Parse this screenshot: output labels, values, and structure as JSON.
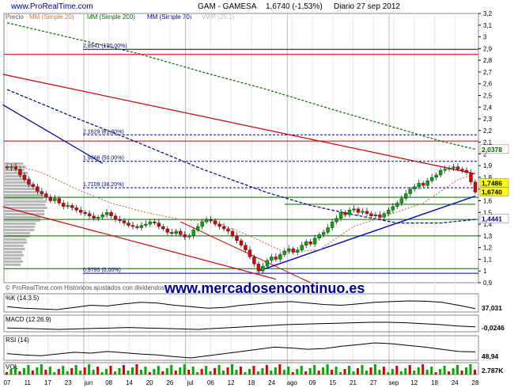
{
  "header": {
    "brand": "www.ProRealTime.com",
    "instrument": "GAM - GAMESA",
    "quote": "1,6740 (-1,53%)",
    "period": "Diario  27 sep 2012"
  },
  "legend": {
    "price": "Precio",
    "ma20": "MM (Simple 20)",
    "ma200": "MM (Simple 200)",
    "ma70": "MM (Simple 70)",
    "vwp": "VWP (25.1)"
  },
  "footer_note": "© ProRealTime.com  Históricos ajustados con dividendos",
  "watermark": "www.mercadosencontinuo.es",
  "colors": {
    "up": "#00aa00",
    "down": "#dd0000",
    "ma20": "#cc7755",
    "ma200": "#006600",
    "ma70": "#000099",
    "fib": "#0000aa",
    "resistance": "#cc0000",
    "support": "#006600",
    "trendline": "#0000cc",
    "watermark": "#000099",
    "highlight": "#ffff00"
  },
  "chart_data": {
    "type": "candlestick",
    "title": "GAM - GAMESA",
    "ylim": [
      0.9,
      3.2
    ],
    "yticks": [
      "3,2",
      "3,1",
      "3",
      "2,9",
      "2,8",
      "2,7",
      "2,6",
      "2,5",
      "2,4",
      "2,3",
      "2,2",
      "2,1",
      "2",
      "1,9",
      "1,8",
      "1,7",
      "1,6",
      "1,5",
      "1,4",
      "1,3",
      "1,2",
      "1,1",
      "1",
      "0,9"
    ],
    "xticks": [
      "07",
      "11",
      "17",
      "23",
      "jun",
      "08",
      "14",
      "20",
      "26",
      "jul",
      "06",
      "12",
      "18",
      "24",
      "ago",
      "09",
      "15",
      "21",
      "27",
      "sep",
      "12",
      "18",
      "24",
      "28"
    ],
    "fibonacci": [
      {
        "label": "2,8941 (100,00%)",
        "value": 2.894
      },
      {
        "label": "2,1629 (61,80%)",
        "value": 2.163
      },
      {
        "label": "1,9368 (50,00%)",
        "value": 1.937
      },
      {
        "label": "1,7109 (38,20%)",
        "value": 1.711
      },
      {
        "label": "0,9795 (0,00%)",
        "value": 0.98
      }
    ],
    "horizontal_levels": [
      {
        "value": 2.85,
        "color": "resistance"
      },
      {
        "value": 2.11,
        "color": "resistance"
      },
      {
        "value": 1.63,
        "color": "support"
      },
      {
        "value": 1.44,
        "color": "support"
      },
      {
        "value": 1.3,
        "color": "support"
      },
      {
        "value": 1.02,
        "color": "support"
      }
    ],
    "price_labels": [
      {
        "text": "2,0378",
        "value": 2.0378,
        "style": "green"
      },
      {
        "text": "1,7486",
        "value": 1.7486,
        "style": "highlight"
      },
      {
        "text": "1,6740",
        "value": 1.674,
        "style": "highlight"
      },
      {
        "text": "1,4441",
        "value": 1.4441,
        "style": "blue"
      }
    ],
    "close": [
      1.88,
      1.89,
      1.87,
      1.82,
      1.78,
      1.74,
      1.72,
      1.68,
      1.66,
      1.63,
      1.6,
      1.62,
      1.58,
      1.55,
      1.56,
      1.54,
      1.52,
      1.5,
      1.49,
      1.47,
      1.45,
      1.46,
      1.48,
      1.5,
      1.47,
      1.44,
      1.43,
      1.41,
      1.39,
      1.38,
      1.37,
      1.39,
      1.4,
      1.42,
      1.41,
      1.38,
      1.36,
      1.33,
      1.32,
      1.34,
      1.31,
      1.29,
      1.3,
      1.35,
      1.38,
      1.42,
      1.44,
      1.43,
      1.4,
      1.38,
      1.36,
      1.34,
      1.3,
      1.26,
      1.22,
      1.18,
      1.12,
      1.06,
      1.0,
      1.04,
      1.09,
      1.12,
      1.1,
      1.14,
      1.17,
      1.19,
      1.16,
      1.18,
      1.22,
      1.25,
      1.23,
      1.28,
      1.31,
      1.33,
      1.37,
      1.42,
      1.45,
      1.5,
      1.48,
      1.52,
      1.53,
      1.5,
      1.51,
      1.49,
      1.47,
      1.48,
      1.46,
      1.49,
      1.52,
      1.55,
      1.58,
      1.62,
      1.66,
      1.7,
      1.72,
      1.75,
      1.73,
      1.77,
      1.8,
      1.82,
      1.86,
      1.87,
      1.88,
      1.89,
      1.87,
      1.86,
      1.84,
      1.76,
      1.674
    ],
    "moving_averages": [
      {
        "name": "MM (Simple 200)",
        "color": "ma200",
        "points": [
          [
            0,
            3.12
          ],
          [
            15,
            2.99
          ],
          [
            30,
            2.86
          ],
          [
            45,
            2.7
          ],
          [
            60,
            2.55
          ],
          [
            75,
            2.38
          ],
          [
            90,
            2.22
          ],
          [
            100,
            2.11
          ],
          [
            108,
            2.04
          ]
        ]
      },
      {
        "name": "MM (Simple 70)",
        "color": "ma70",
        "points": [
          [
            0,
            2.55
          ],
          [
            15,
            2.32
          ],
          [
            30,
            2.1
          ],
          [
            45,
            1.87
          ],
          [
            60,
            1.67
          ],
          [
            70,
            1.56
          ],
          [
            80,
            1.48
          ],
          [
            90,
            1.41
          ],
          [
            100,
            1.41
          ],
          [
            108,
            1.44
          ]
        ]
      },
      {
        "name": "MM (Simple 20)",
        "color": "ma20",
        "points": [
          [
            0,
            1.92
          ],
          [
            8,
            1.84
          ],
          [
            16,
            1.7
          ],
          [
            24,
            1.58
          ],
          [
            32,
            1.5
          ],
          [
            40,
            1.44
          ],
          [
            48,
            1.42
          ],
          [
            56,
            1.3
          ],
          [
            64,
            1.16
          ],
          [
            72,
            1.18
          ],
          [
            80,
            1.38
          ],
          [
            88,
            1.48
          ],
          [
            96,
            1.58
          ],
          [
            104,
            1.78
          ],
          [
            108,
            1.83
          ]
        ]
      }
    ],
    "indicators": [
      {
        "label": "%K (14.3.5)",
        "values": [
          50,
          40,
          35,
          30,
          45,
          60,
          55,
          70,
          80,
          75,
          60,
          50,
          40,
          45,
          60,
          70,
          80,
          85,
          75,
          65,
          60,
          70,
          80,
          85,
          90,
          88,
          80,
          60,
          37
        ],
        "readout": "37,031"
      },
      {
        "label": "MACD (12.26.9)",
        "values": [
          -0.05,
          -0.06,
          -0.07,
          -0.08,
          -0.07,
          -0.06,
          -0.05,
          -0.04,
          -0.05,
          -0.06,
          -0.07,
          -0.08,
          -0.06,
          -0.04,
          -0.02,
          0.0,
          0.02,
          0.03,
          0.04,
          0.05,
          0.06,
          0.07,
          0.07,
          0.06,
          0.04,
          0.02,
          -0.01,
          -0.025
        ],
        "readout": "-0,0246"
      },
      {
        "label": "RSI (14)",
        "values": [
          45,
          42,
          40,
          44,
          48,
          46,
          50,
          47,
          44,
          42,
          38,
          35,
          40,
          45,
          50,
          55,
          60,
          58,
          55,
          57,
          62,
          66,
          70,
          68,
          64,
          60,
          55,
          50,
          48.94
        ],
        "readout": "48,94"
      },
      {
        "label": "VOL",
        "readout": "2.787K"
      }
    ]
  }
}
